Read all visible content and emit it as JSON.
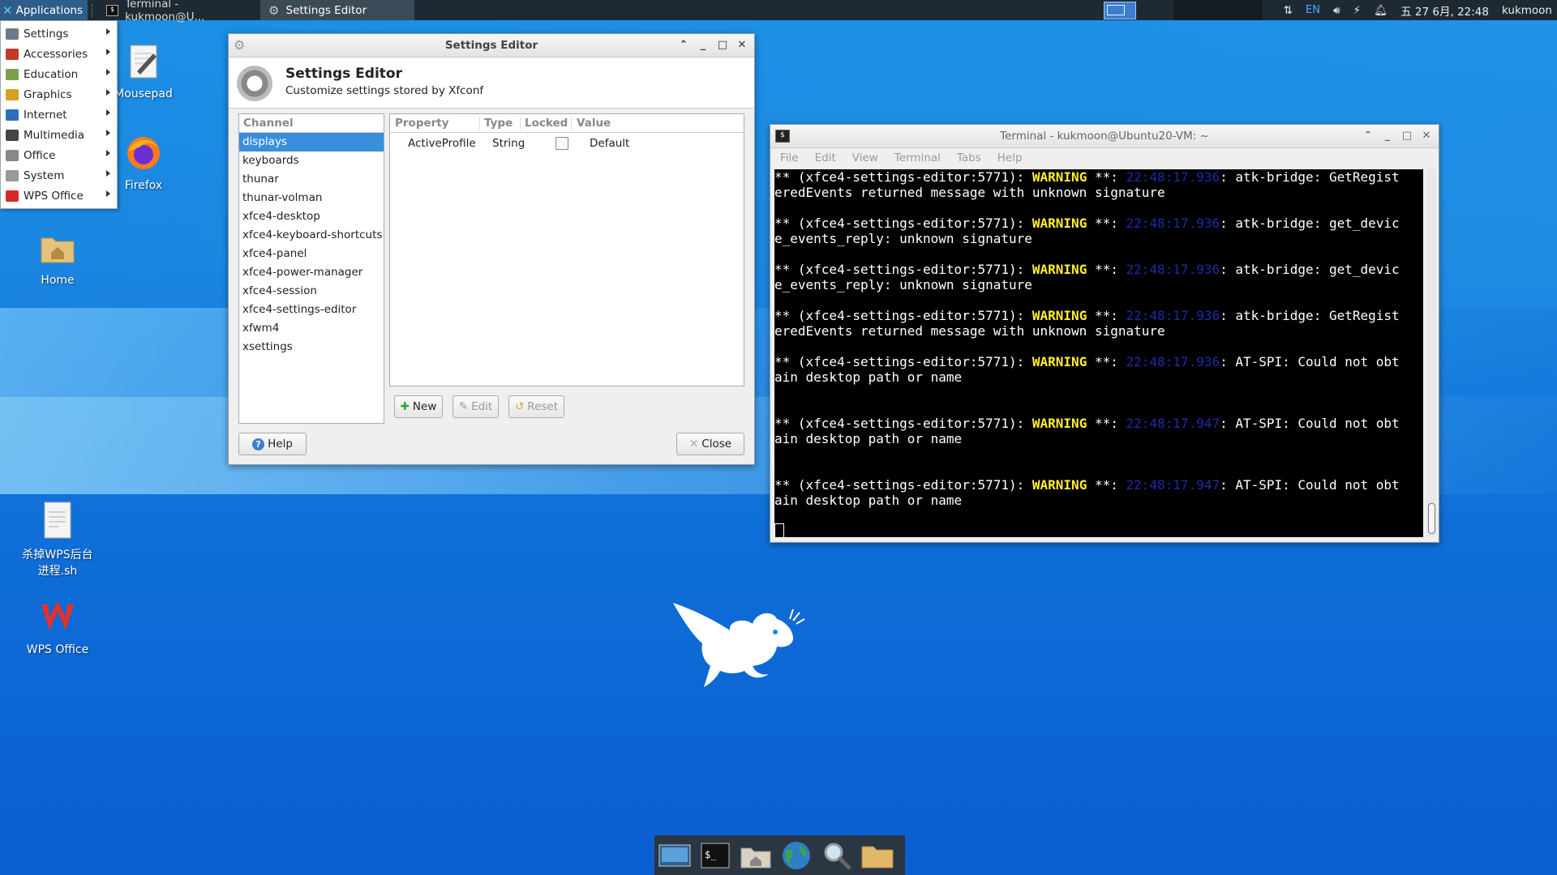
{
  "top_panel": {
    "applications_label": "Applications",
    "tasks": [
      {
        "label": "Terminal - kukmoon@U...",
        "icon": "terminal-icon"
      },
      {
        "label": "Settings Editor",
        "icon": "gear-icon"
      }
    ],
    "tray": {
      "language": "EN",
      "clock": "五 27 6月, 22:48",
      "user": "kukmoon"
    }
  },
  "app_menu": {
    "items": [
      {
        "label": "Settings",
        "icon": "settings-icon",
        "color": "#6a7a8c"
      },
      {
        "label": "Accessories",
        "icon": "accessories-icon",
        "color": "#c23a2a"
      },
      {
        "label": "Education",
        "icon": "education-icon",
        "color": "#7aa04a"
      },
      {
        "label": "Graphics",
        "icon": "graphics-icon",
        "color": "#d8a020"
      },
      {
        "label": "Internet",
        "icon": "internet-icon",
        "color": "#2a6fb8"
      },
      {
        "label": "Multimedia",
        "icon": "multimedia-icon",
        "color": "#444444"
      },
      {
        "label": "Office",
        "icon": "office-icon",
        "color": "#888888"
      },
      {
        "label": "System",
        "icon": "system-icon",
        "color": "#999999"
      },
      {
        "label": "WPS Office",
        "icon": "wps-icon",
        "color": "#d42a2a"
      }
    ]
  },
  "desktop_icons": {
    "mousepad": "Mousepad",
    "firefox": "Firefox",
    "home": "Home",
    "script_line1": "杀掉WPS后台",
    "script_line2": "进程.sh",
    "wps": "WPS Office"
  },
  "settings_editor": {
    "window_title": "Settings Editor",
    "header_title": "Settings Editor",
    "header_subtitle": "Customize settings stored by Xfconf",
    "channel_header": "Channel",
    "channels": [
      "displays",
      "keyboards",
      "thunar",
      "thunar-volman",
      "xfce4-desktop",
      "xfce4-keyboard-shortcuts",
      "xfce4-panel",
      "xfce4-power-manager",
      "xfce4-session",
      "xfce4-settings-editor",
      "xfwm4",
      "xsettings"
    ],
    "selected_channel": "displays",
    "property_headers": {
      "property": "Property",
      "type": "Type",
      "locked": "Locked",
      "value": "Value"
    },
    "properties": [
      {
        "property": "ActiveProfile",
        "type": "String",
        "locked": false,
        "value": "Default"
      }
    ],
    "buttons": {
      "new": "New",
      "edit": "Edit",
      "reset": "Reset",
      "help": "Help",
      "close": "Close"
    }
  },
  "terminal": {
    "window_title": "Terminal - kukmoon@Ubuntu20-VM: ~",
    "menu": [
      "File",
      "Edit",
      "View",
      "Terminal",
      "Tabs",
      "Help"
    ],
    "lines": [
      {
        "pre": "** (xfce4-settings-editor:5771): ",
        "warn": "WARNING",
        "mid": " **: ",
        "ts": "22:48:17.936",
        "post": ": atk-bridge: GetRegist"
      },
      {
        "text": "eredEvents returned message with unknown signature"
      },
      {
        "text": ""
      },
      {
        "pre": "** (xfce4-settings-editor:5771): ",
        "warn": "WARNING",
        "mid": " **: ",
        "ts": "22:48:17.936",
        "post": ": atk-bridge: get_devic"
      },
      {
        "text": "e_events_reply: unknown signature"
      },
      {
        "text": ""
      },
      {
        "pre": "** (xfce4-settings-editor:5771): ",
        "warn": "WARNING",
        "mid": " **: ",
        "ts": "22:48:17.936",
        "post": ": atk-bridge: get_devic"
      },
      {
        "text": "e_events_reply: unknown signature"
      },
      {
        "text": ""
      },
      {
        "pre": "** (xfce4-settings-editor:5771): ",
        "warn": "WARNING",
        "mid": " **: ",
        "ts": "22:48:17.936",
        "post": ": atk-bridge: GetRegist"
      },
      {
        "text": "eredEvents returned message with unknown signature"
      },
      {
        "text": ""
      },
      {
        "pre": "** (xfce4-settings-editor:5771): ",
        "warn": "WARNING",
        "mid": " **: ",
        "ts": "22:48:17.936",
        "post": ": AT-SPI: Could not obt"
      },
      {
        "text": "ain desktop path or name"
      },
      {
        "text": ""
      },
      {
        "text": ""
      },
      {
        "pre": "** (xfce4-settings-editor:5771): ",
        "warn": "WARNING",
        "mid": " **: ",
        "ts": "22:48:17.947",
        "post": ": AT-SPI: Could not obt"
      },
      {
        "text": "ain desktop path or name"
      },
      {
        "text": ""
      },
      {
        "text": ""
      },
      {
        "pre": "** (xfce4-settings-editor:5771): ",
        "warn": "WARNING",
        "mid": " **: ",
        "ts": "22:48:17.947",
        "post": ": AT-SPI: Could not obt"
      },
      {
        "text": "ain desktop path or name"
      },
      {
        "text": ""
      }
    ]
  },
  "dock": {
    "items": [
      "show-desktop-icon",
      "terminal-icon",
      "home-folder-icon",
      "web-browser-icon",
      "search-icon",
      "file-manager-icon"
    ]
  }
}
